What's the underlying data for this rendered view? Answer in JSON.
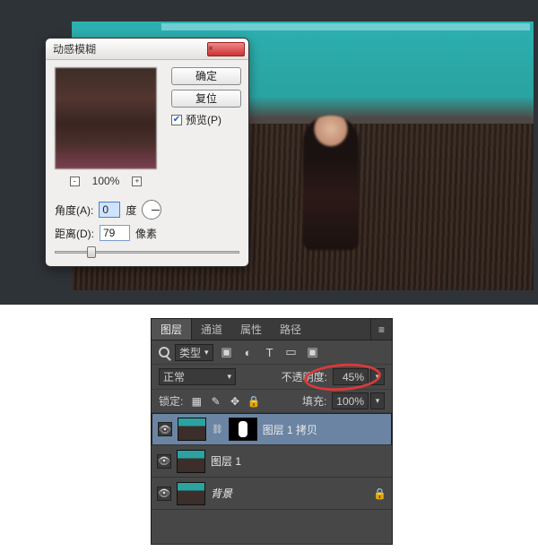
{
  "dialog": {
    "title": "动感模糊",
    "close": "×",
    "ok": "确定",
    "reset": "复位",
    "preview_checkbox": "预览(P)",
    "zoom": "100%",
    "angle_label": "角度(A):",
    "angle_value": "0",
    "angle_unit": "度",
    "distance_label": "距离(D):",
    "distance_value": "79",
    "distance_unit": "像素"
  },
  "panel": {
    "tabs": {
      "layers": "图层",
      "channels": "通道",
      "properties": "属性",
      "paths": "路径"
    },
    "filterRow": {
      "kind": "类型",
      "icons": {
        "img": "▣",
        "adj": "◐",
        "type": "T",
        "shape": "▭",
        "smart": "▣"
      }
    },
    "blendRow": {
      "mode": "正常",
      "opacityLabel": "不透明度:",
      "opacityValue": "45%"
    },
    "lockRow": {
      "label": "锁定:",
      "icons": {
        "pixels": "▦",
        "position": "✎",
        "move": "✥",
        "all": "🔒"
      },
      "fillLabel": "填充:",
      "fillValue": "100%"
    },
    "layers": [
      {
        "name": "图层 1 拷贝",
        "hasMask": true,
        "selected": true
      },
      {
        "name": "图层 1",
        "hasMask": false,
        "selected": false
      },
      {
        "name": "背景",
        "hasMask": false,
        "selected": false,
        "locked": true
      }
    ]
  }
}
